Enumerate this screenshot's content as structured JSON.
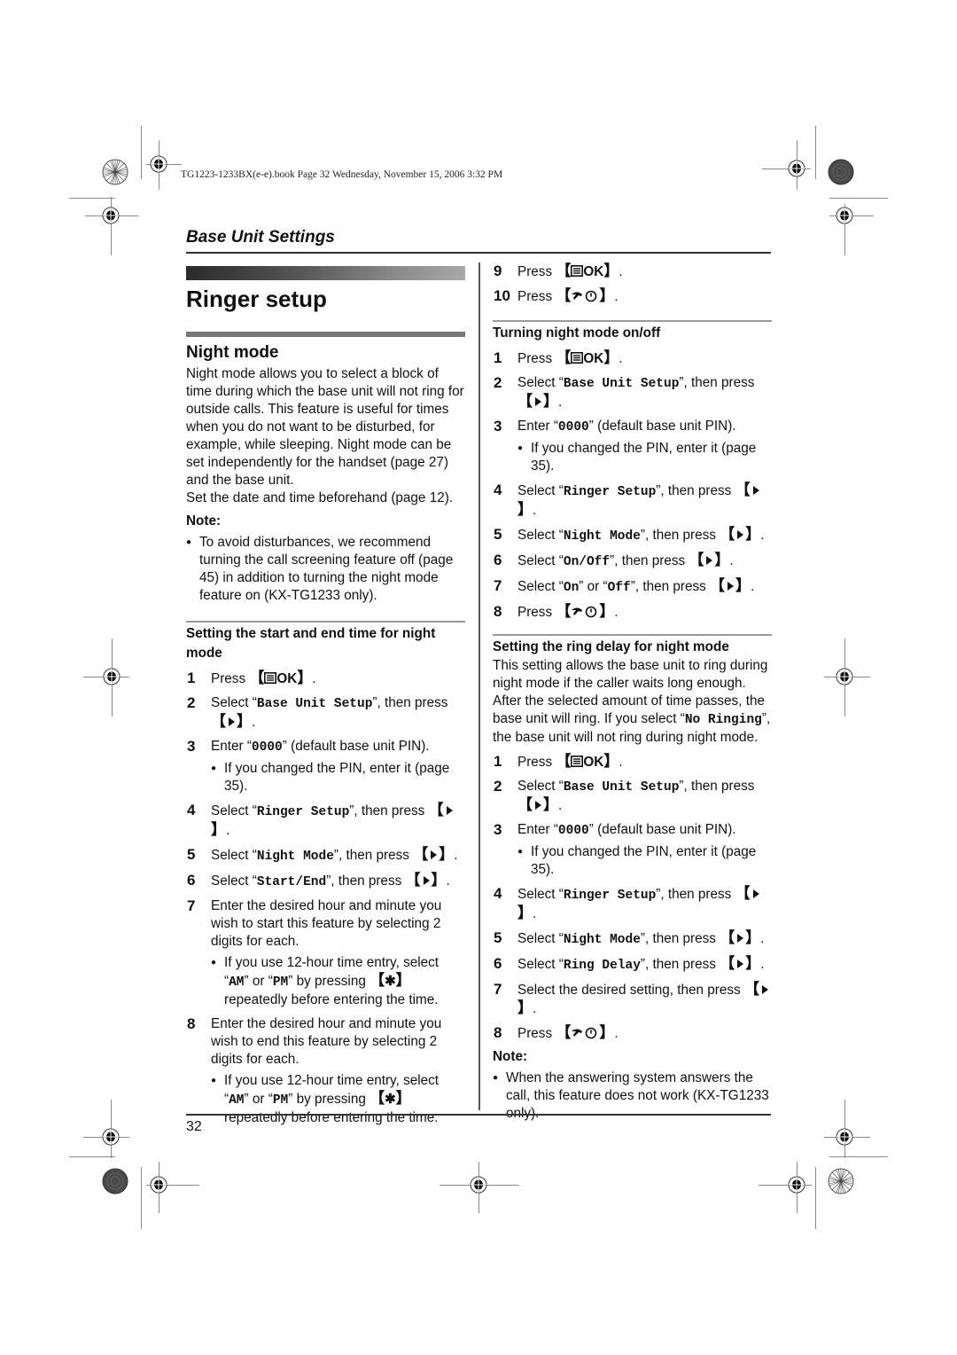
{
  "print_info": "TG1223-1233BX(e-e).book  Page 32  Wednesday, November 15, 2006  3:32 PM",
  "section_header": "Base Unit Settings",
  "page_title": "Ringer setup",
  "subsection_title": "Night mode",
  "intro": {
    "paragraph": "Night mode allows you to select a block of time during which the base unit will not ring for outside calls. This feature is useful for times when you do not want to be disturbed, for example, while sleeping. Night mode can be set independently for the handset (page 27) and the base unit.",
    "prereq": "Set the date and time beforehand (page 12).",
    "note_label": "Note:",
    "note_bullet": "To avoid disturbances, we recommend turning the call screening feature off (page 45) in addition to turning the night mode feature on (KX-TG1233 only)."
  },
  "keys": {
    "menu_ok": "OK",
    "right": "▶",
    "off": "⏻",
    "star": "✱"
  },
  "start_end": {
    "title": "Setting the start and end time for night mode",
    "steps": [
      {
        "num": "1",
        "pre": "Press ",
        "key": "menu_ok"
      },
      {
        "num": "2",
        "pre": "Select ",
        "item": "Base Unit Setup",
        "post": ", then press "
      },
      {
        "num": "3",
        "pre": "Enter ",
        "item": "0000",
        "post": " (default base unit PIN).",
        "bullet": "If you changed the PIN, enter it (page 35)."
      },
      {
        "num": "4",
        "pre": "Select ",
        "item": "Ringer Setup",
        "post": ", then press "
      },
      {
        "num": "5",
        "pre": "Select ",
        "item": "Night Mode",
        "post": ", then press "
      },
      {
        "num": "6",
        "pre": "Select ",
        "item": "Start/End",
        "post": ", then press "
      },
      {
        "num": "7",
        "text": "Enter the desired hour and minute you wish to start this feature by selecting 2 digits for each.",
        "bullet_pre": "If you use 12-hour time entry, select ",
        "am": "AM",
        "or": " or ",
        "pm": "PM",
        "bullet_mid": " by pressing ",
        "bullet_post": " repeatedly before entering the time."
      },
      {
        "num": "8",
        "text": "Enter the desired hour and minute you wish to end this feature by selecting 2 digits for each.",
        "bullet_pre": "If you use 12-hour time entry, select ",
        "am": "AM",
        "or": " or ",
        "pm": "PM",
        "bullet_mid": " by pressing ",
        "bullet_post": " repeatedly before entering the time."
      },
      {
        "num": "9",
        "pre": "Press "
      },
      {
        "num": "10",
        "pre": "Press "
      }
    ]
  },
  "on_off": {
    "title": "Turning night mode on/off",
    "steps": [
      {
        "num": "1",
        "pre": "Press "
      },
      {
        "num": "2",
        "pre": "Select ",
        "item": "Base Unit Setup",
        "post": ", then press "
      },
      {
        "num": "3",
        "pre": "Enter ",
        "item": "0000",
        "post": " (default base unit PIN).",
        "bullet": "If you changed the PIN, enter it (page 35)."
      },
      {
        "num": "4",
        "pre": "Select ",
        "item": "Ringer Setup",
        "post": ", then press "
      },
      {
        "num": "5",
        "pre": "Select ",
        "item": "Night Mode",
        "post": ", then press "
      },
      {
        "num": "6",
        "pre": "Select ",
        "item": "On/Off",
        "post": ", then press "
      },
      {
        "num": "7",
        "pre": "Select ",
        "item": "On",
        "mid": " or ",
        "item2": "Off",
        "post": ", then press "
      },
      {
        "num": "8",
        "pre": "Press "
      }
    ]
  },
  "ring_delay": {
    "title": "Setting the ring delay for night mode",
    "desc_pre": "This setting allows the base unit to ring during night mode if the caller waits long enough. After the selected amount of time passes, the base unit will ring. If you select ",
    "desc_item": "No Ringing",
    "desc_post": ", the base unit will not ring during night mode.",
    "steps": [
      {
        "num": "1",
        "pre": "Press "
      },
      {
        "num": "2",
        "pre": "Select ",
        "item": "Base Unit Setup",
        "post": ", then press "
      },
      {
        "num": "3",
        "pre": "Enter ",
        "item": "0000",
        "post": " (default base unit PIN).",
        "bullet": "If you changed the PIN, enter it (page 35)."
      },
      {
        "num": "4",
        "pre": "Select ",
        "item": "Ringer Setup",
        "post": ", then press "
      },
      {
        "num": "5",
        "pre": "Select ",
        "item": "Night Mode",
        "post": ", then press "
      },
      {
        "num": "6",
        "pre": "Select ",
        "item": "Ring Delay",
        "post": ", then press "
      },
      {
        "num": "7",
        "text": "Select the desired setting, then press "
      },
      {
        "num": "8",
        "pre": "Press "
      }
    ],
    "note_label": "Note:",
    "note_bullet": "When the answering system answers the call, this feature does not work (KX-TG1233 only)."
  },
  "page_number": "32"
}
